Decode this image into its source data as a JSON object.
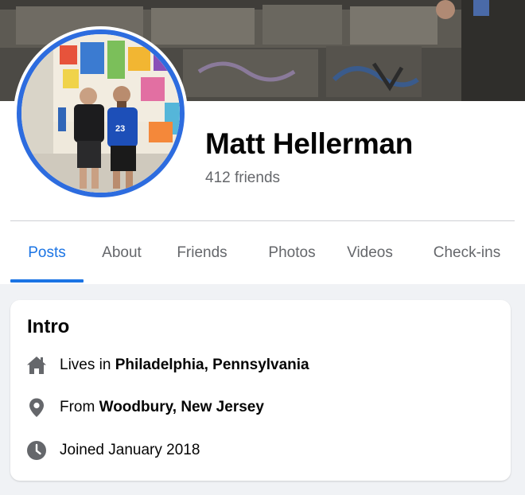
{
  "profile": {
    "name": "Matt Hellerman",
    "friends": "412 friends"
  },
  "tabs": [
    {
      "label": "Posts",
      "active": true
    },
    {
      "label": "About",
      "active": false
    },
    {
      "label": "Friends",
      "active": false
    },
    {
      "label": "Photos",
      "active": false
    },
    {
      "label": "Videos",
      "active": false
    },
    {
      "label": "Check-ins",
      "active": false
    }
  ],
  "intro": {
    "title": "Intro",
    "items": [
      {
        "icon": "home-icon",
        "prefix": "Lives in ",
        "value": "Philadelphia, Pennsylvania"
      },
      {
        "icon": "location-pin-icon",
        "prefix": "From ",
        "value": "Woodbury, New Jersey"
      },
      {
        "icon": "clock-icon",
        "prefix": "Joined January 2018",
        "value": ""
      }
    ]
  },
  "colors": {
    "accent": "#1b74e4",
    "avatar_ring": "#2d6cdf",
    "secondary_text": "#65676b",
    "page_background": "#f0f2f5"
  }
}
